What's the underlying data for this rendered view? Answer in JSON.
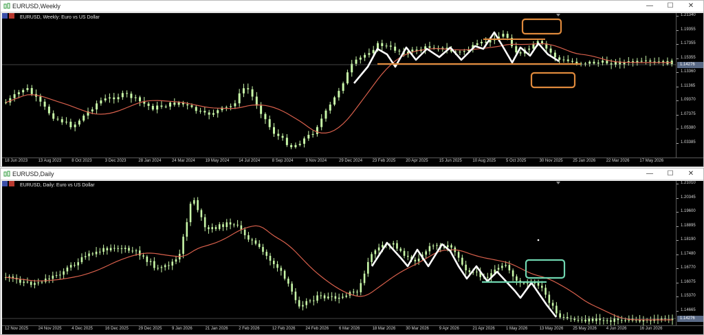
{
  "windows": [
    {
      "id": "weekly",
      "title": "EURUSD,Weekly",
      "symbol_label": "EURUSD, Weekly:  Euro vs US Dollar",
      "current_price": "1.14276",
      "price_ticks": [
        "1.21340",
        "1.19355",
        "1.17355",
        "1.15355",
        "1.13360",
        "1.11365",
        "1.09370",
        "1.07375",
        "1.05380",
        "1.03385"
      ],
      "time_ticks": [
        "18 Jun 2023",
        "13 Aug 2023",
        "8 Oct 2023",
        "3 Dec 2023",
        "28 Jan 2024",
        "24 Mar 2024",
        "19 May 2024",
        "14 Jul 2024",
        "8 Sep 2024",
        "3 Nov 2024",
        "29 Dec 2024",
        "23 Feb 2025",
        "20 Apr 2025",
        "15 Jun 2025",
        "10 Aug 2025",
        "5 Oct 2025",
        "30 Nov 2025",
        "25 Jan 2026",
        "22 Mar 2026",
        "17 May 2026"
      ]
    },
    {
      "id": "daily",
      "title": "EURUSD,Daily",
      "symbol_label": "EURUSD, Daily:  Euro vs US Dollar",
      "current_price": "1.14276",
      "price_ticks": [
        "1.21010",
        "1.20345",
        "1.19600",
        "1.18895",
        "1.18190",
        "1.17480",
        "1.16770",
        "1.16075",
        "1.15370",
        "1.14665"
      ],
      "time_ticks": [
        "12 Nov 2025",
        "24 Nov 2025",
        "4 Dec 2025",
        "16 Dec 2025",
        "29 Dec 2025",
        "9 Jan 2026",
        "21 Jan 2026",
        "2 Feb 2026",
        "12 Feb 2026",
        "24 Feb 2026",
        "6 Mar 2026",
        "18 Mar 2026",
        "30 Mar 2026",
        "9 Apr 2026",
        "21 Apr 2026",
        "1 May 2026",
        "13 May 2026",
        "25 May 2026",
        "4 Jun 2026",
        "16 Jun 2026"
      ]
    }
  ],
  "window_buttons": {
    "minimize": "—",
    "maximize": "☐",
    "close": "✕"
  },
  "colors": {
    "candle": "#c8f7a8",
    "ma": "#d9604c",
    "pattern": "#ffffff",
    "weekly_annotation": "#e08a3c",
    "daily_annotation": "#6fd6b0",
    "background": "#000000"
  },
  "icons": [
    "chart-window-icon",
    "symbol-flag-icon",
    "minimize-icon",
    "maximize-icon",
    "close-icon"
  ]
}
